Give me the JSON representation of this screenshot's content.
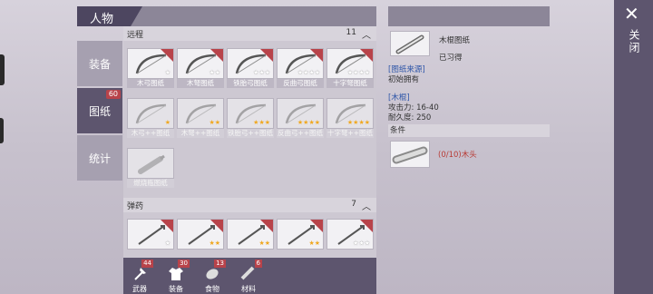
{
  "title": "人物",
  "nav": [
    {
      "label": "装备"
    },
    {
      "label": "图纸",
      "badge": "60"
    },
    {
      "label": "统计"
    }
  ],
  "sections": [
    {
      "name": "远程",
      "count": "11",
      "items": [
        {
          "label": "木弓图纸",
          "stars": "★",
          "gold": false,
          "dim": false
        },
        {
          "label": "木弩图纸",
          "stars": "★★",
          "gold": false,
          "dim": false
        },
        {
          "label": "铁胎弓图纸",
          "stars": "★★★",
          "gold": false,
          "dim": false
        },
        {
          "label": "反曲弓图纸",
          "stars": "★★★★",
          "gold": false,
          "dim": false
        },
        {
          "label": "十字弩图纸",
          "stars": "★★★★",
          "gold": false,
          "dim": false
        },
        {
          "label": "木弓++图纸",
          "stars": "★",
          "gold": true,
          "dim": true
        },
        {
          "label": "木弩++图纸",
          "stars": "★★",
          "gold": true,
          "dim": true
        },
        {
          "label": "铁胎弓++图纸",
          "stars": "★★★",
          "gold": true,
          "dim": true
        },
        {
          "label": "反曲弓++图纸",
          "stars": "★★★★",
          "gold": true,
          "dim": true
        },
        {
          "label": "十字弩++图纸",
          "stars": "★★★★",
          "gold": true,
          "dim": true
        },
        {
          "label": "燃烧瓶图纸",
          "stars": "",
          "gold": false,
          "dim": true
        }
      ]
    },
    {
      "name": "弹药",
      "count": "7",
      "items": [
        {
          "label": "",
          "stars": "★",
          "gold": false,
          "dim": false
        },
        {
          "label": "",
          "stars": "★★",
          "gold": true,
          "dim": false
        },
        {
          "label": "",
          "stars": "★★",
          "gold": true,
          "dim": false
        },
        {
          "label": "",
          "stars": "★★",
          "gold": true,
          "dim": false
        },
        {
          "label": "",
          "stars": "★★★",
          "gold": false,
          "dim": false
        }
      ]
    }
  ],
  "bottom_tabs": [
    {
      "label": "武器",
      "badge": "44"
    },
    {
      "label": "装备",
      "badge": "30"
    },
    {
      "label": "食物",
      "badge": "13"
    },
    {
      "label": "材料",
      "badge": "6"
    }
  ],
  "detail": {
    "name": "木棍图纸",
    "status": "已习得",
    "source_label": "[图纸来源]",
    "source_value": "初始拥有",
    "item_name": "[木棍]",
    "attack": "攻击力: 16-40",
    "durability": "耐久度: 250",
    "conditions_label": "条件",
    "requirement": "(0/10)木头"
  },
  "close": {
    "label": "关闭"
  },
  "colors": {
    "accent": "#5d556e",
    "badge": "#b8434a",
    "gold": "#f0a820",
    "link": "#2e56a8"
  }
}
